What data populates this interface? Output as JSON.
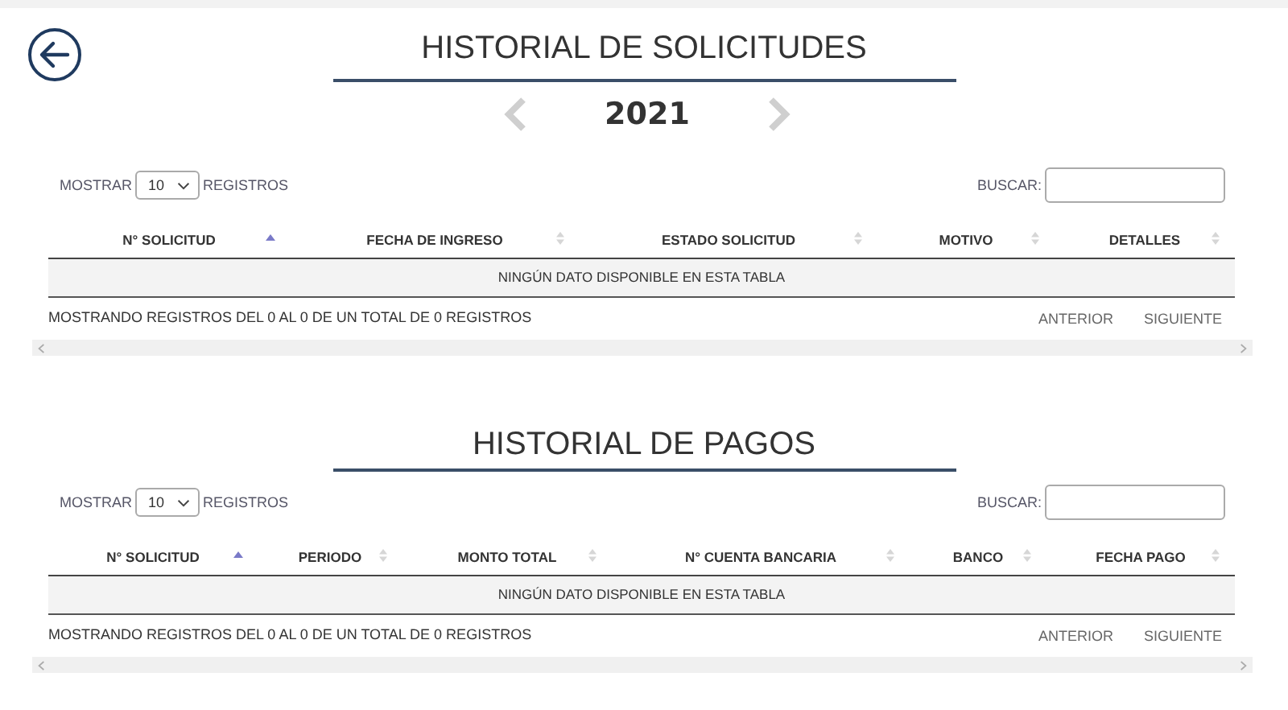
{
  "sections": [
    {
      "title": "HISTORIAL DE SOLICITUDES",
      "year": "2021",
      "length_before": "MOSTRAR",
      "length_value": "10",
      "length_after": "REGISTROS",
      "search_label": "BUSCAR:",
      "columns": [
        {
          "label": "N° SOLICITUD",
          "sorted": true
        },
        {
          "label": "FECHA DE INGRESO",
          "sorted": false
        },
        {
          "label": "ESTADO SOLICITUD",
          "sorted": false
        },
        {
          "label": "MOTIVO",
          "sorted": false
        },
        {
          "label": "DETALLES",
          "sorted": false
        }
      ],
      "empty_message": "NINGÚN DATO DISPONIBLE EN ESTA TABLA",
      "info": "MOSTRANDO REGISTROS DEL 0 AL 0 DE UN TOTAL DE 0 REGISTROS",
      "pagination": [
        "ANTERIOR",
        "SIGUIENTE"
      ]
    },
    {
      "title": "HISTORIAL DE PAGOS",
      "length_before": "MOSTRAR",
      "length_value": "10",
      "length_after": "REGISTROS",
      "search_label": "BUSCAR:",
      "columns": [
        {
          "label": "N° SOLICITUD",
          "sorted": true
        },
        {
          "label": "PERIODO",
          "sorted": false
        },
        {
          "label": "MONTO TOTAL",
          "sorted": false
        },
        {
          "label": "N° CUENTA BANCARIA",
          "sorted": false
        },
        {
          "label": "BANCO",
          "sorted": false
        },
        {
          "label": "FECHA PAGO",
          "sorted": false
        }
      ],
      "empty_message": "NINGÚN DATO DISPONIBLE EN ESTA TABLA",
      "info": "MOSTRANDO REGISTROS DEL 0 AL 0 DE UN TOTAL DE 0 REGISTROS",
      "pagination": [
        "ANTERIOR",
        "SIGUIENTE"
      ]
    }
  ]
}
